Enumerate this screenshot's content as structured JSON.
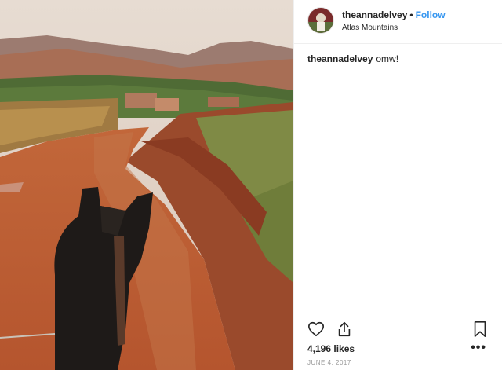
{
  "post": {
    "username": "theannadelvey",
    "separator": "•",
    "follow_label": "Follow",
    "location": "Atlas Mountains",
    "caption_user": "theannadelvey",
    "caption_text": "omw!",
    "likes": "4,196 likes",
    "date": "JUNE 4, 2017",
    "more_label": "•••"
  },
  "icons": {
    "like": "heart-icon",
    "share": "share-icon",
    "save": "bookmark-icon",
    "more": "more-options-icon"
  },
  "colors": {
    "follow": "#3897f0",
    "text": "#262626",
    "muted": "#999999",
    "divider": "#efefef"
  }
}
